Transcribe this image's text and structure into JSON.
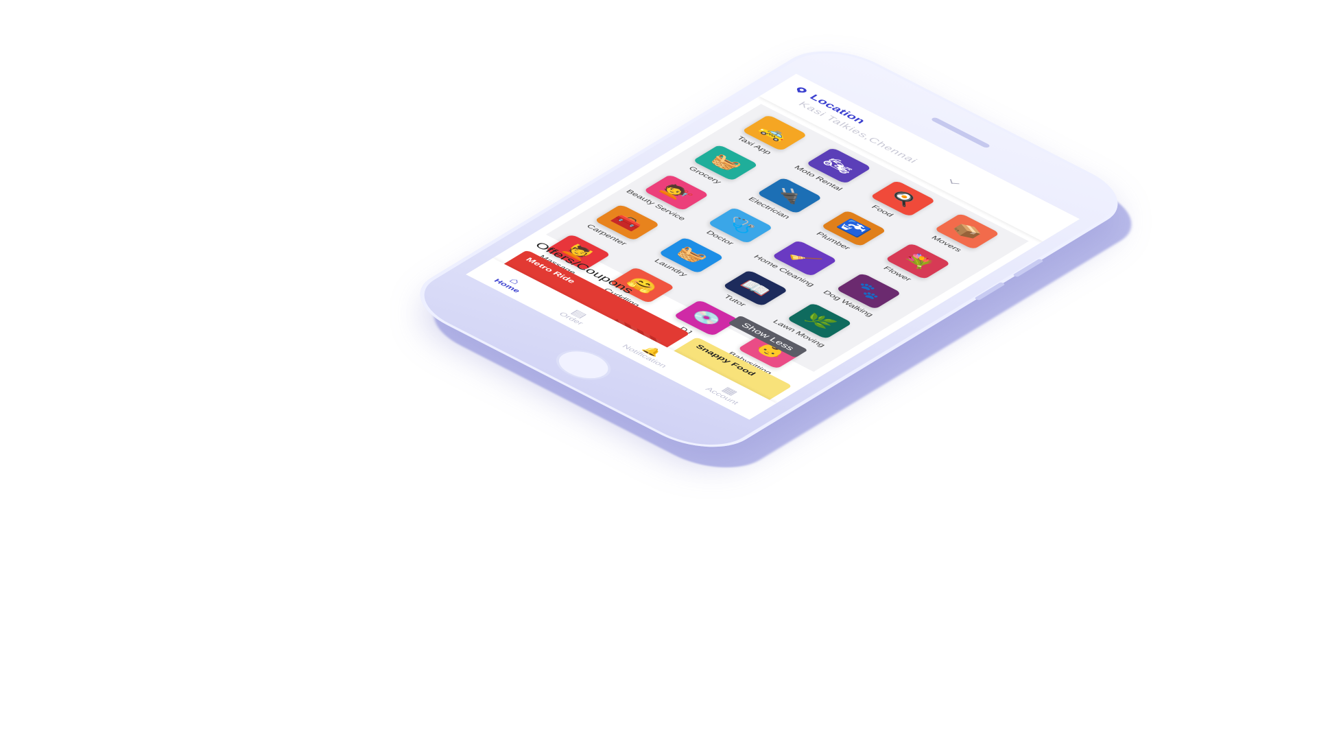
{
  "header": {
    "location_label": "Location",
    "location_value": "Kasi Talkies,Chennai"
  },
  "services": [
    {
      "label": "Taxi App",
      "color": "#f5a623",
      "icon": "car-icon",
      "glyph": "🚕"
    },
    {
      "label": "Moto Rental",
      "color": "#5b3fb8",
      "icon": "motorcycle-icon",
      "glyph": "🏍"
    },
    {
      "label": "Food",
      "color": "#f04a3a",
      "icon": "chef-hat-icon",
      "glyph": "🍳"
    },
    {
      "label": "Movers",
      "color": "#f26b4b",
      "icon": "box-icon",
      "glyph": "📦"
    },
    {
      "label": "Grocery",
      "color": "#1fae9a",
      "icon": "grocery-basket-icon",
      "glyph": "🧺"
    },
    {
      "label": "Electrician",
      "color": "#1c6fb5",
      "icon": "plug-icon",
      "glyph": "🔌"
    },
    {
      "label": "Plumber",
      "color": "#e07f1a",
      "icon": "tap-icon",
      "glyph": "🚰"
    },
    {
      "label": "Flower",
      "color": "#d73a55",
      "icon": "flower-icon",
      "glyph": "💐"
    },
    {
      "label": "Beauty Service",
      "color": "#ec3f7a",
      "icon": "hair-dryer-icon",
      "glyph": "💇"
    },
    {
      "label": "Doctor",
      "color": "#3aa6e8",
      "icon": "stethoscope-icon",
      "glyph": "🩺"
    },
    {
      "label": "Home Cleaning",
      "color": "#6a3ac2",
      "icon": "vacuum-icon",
      "glyph": "🧹"
    },
    {
      "label": "Dog Walking",
      "color": "#6b2a6f",
      "icon": "paw-icon",
      "glyph": "🐾"
    },
    {
      "label": "Carpenter",
      "color": "#e8831d",
      "icon": "toolbox-icon",
      "glyph": "🧰"
    },
    {
      "label": "Laundry",
      "color": "#1d8ee6",
      "icon": "washing-machine-icon",
      "glyph": "🧺"
    },
    {
      "label": "Tutor",
      "color": "#1d2b5c",
      "icon": "book-icon",
      "glyph": "📖"
    },
    {
      "label": "Lawn Moving",
      "color": "#0f6b5e",
      "icon": "lawnmower-icon",
      "glyph": "🌿"
    },
    {
      "label": "Massage",
      "color": "#e8353b",
      "icon": "massage-icon",
      "glyph": "💆"
    },
    {
      "label": "Cuddling",
      "color": "#f0543f",
      "icon": "cuddle-icon",
      "glyph": "🤗"
    },
    {
      "label": "DJ",
      "color": "#cf2aa6",
      "icon": "disc-icon",
      "glyph": "💿"
    },
    {
      "label": "Babysitting",
      "color": "#ea4c86",
      "icon": "stroller-icon",
      "glyph": "👶"
    }
  ],
  "show_less_label": "Show Less",
  "offers": {
    "title": "Offers/Coupons",
    "cards": [
      {
        "name": "Metro Ride"
      },
      {
        "name": "Snappy Food"
      }
    ]
  },
  "nav": {
    "home": "Home",
    "order": "Order",
    "notification": "Notification",
    "account": "Account"
  }
}
